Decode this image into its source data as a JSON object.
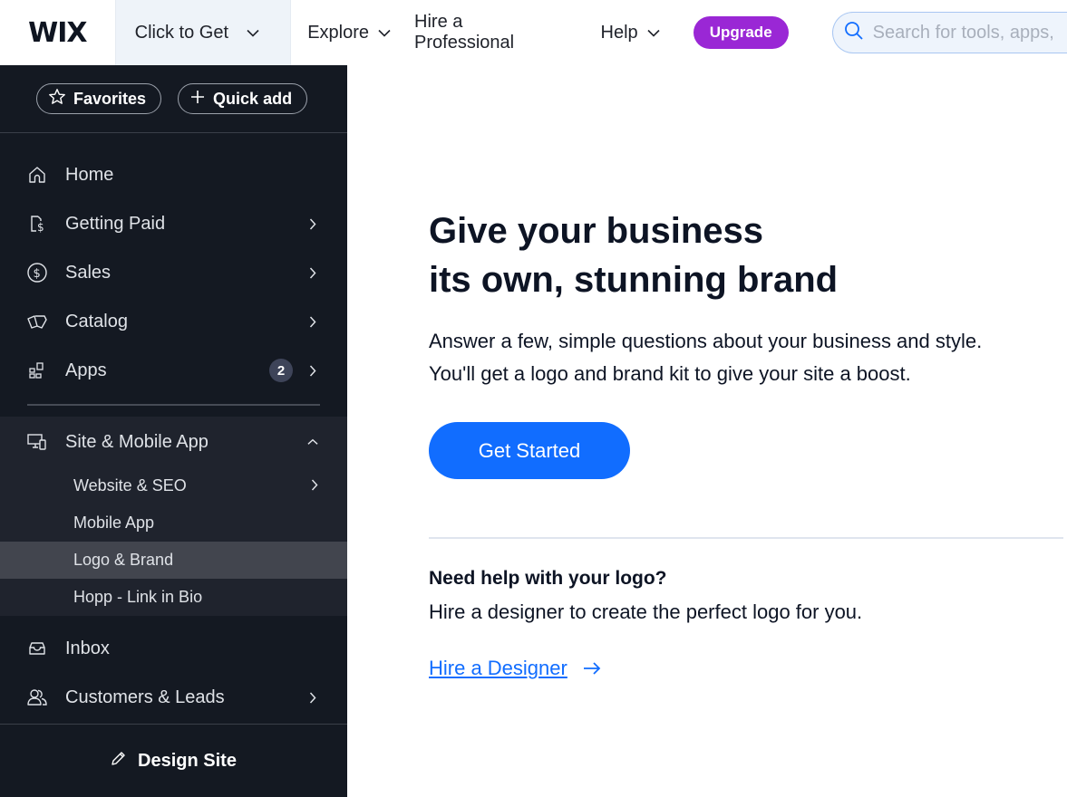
{
  "topbar": {
    "logo": "WIX",
    "site_switcher": "Click to Get",
    "nav": [
      {
        "label": "Explore",
        "has_dropdown": true
      },
      {
        "label": "Hire a Professional",
        "has_dropdown": false
      },
      {
        "label": "Help",
        "has_dropdown": true
      }
    ],
    "upgrade_label": "Upgrade",
    "search_placeholder": "Search for tools, apps, help & more..."
  },
  "sidebar": {
    "favorites_label": "Favorites",
    "quick_add_label": "Quick add",
    "items": [
      {
        "label": "Home",
        "icon": "home-icon"
      },
      {
        "label": "Getting Paid",
        "icon": "invoice-dollar-icon",
        "has_arrow": true
      },
      {
        "label": "Sales",
        "icon": "dollar-circle-icon",
        "has_arrow": true
      },
      {
        "label": "Catalog",
        "icon": "catalog-cards-icon",
        "has_arrow": true
      },
      {
        "label": "Apps",
        "icon": "apps-grid-icon",
        "badge": "2",
        "has_arrow": true
      }
    ],
    "group": {
      "label": "Site & Mobile App",
      "icon": "devices-icon",
      "expanded": true,
      "sub_items": [
        {
          "label": "Website & SEO",
          "has_arrow": true
        },
        {
          "label": "Mobile App"
        },
        {
          "label": "Logo & Brand",
          "active": true
        },
        {
          "label": "Hopp - Link in Bio"
        }
      ]
    },
    "bottom_items": [
      {
        "label": "Inbox",
        "icon": "inbox-icon"
      },
      {
        "label": "Customers & Leads",
        "icon": "people-icon",
        "has_arrow": true
      }
    ],
    "footer_label": "Design Site"
  },
  "main": {
    "headline_line1": "Give your business",
    "headline_line2": "its own, stunning brand",
    "subtext_line1": "Answer a few, simple questions about your business and style.",
    "subtext_line2": "You'll get a logo and brand kit to give your site a boost.",
    "cta_label": "Get Started",
    "help_title": "Need help with your logo?",
    "help_text": "Hire a designer to create the perfect logo for you.",
    "hire_link": "Hire a Designer"
  },
  "colors": {
    "accent": "#116dff",
    "upgrade": "#9a27d5",
    "sidebar_bg": "#141922",
    "sidebar_group_bg": "#1f232d",
    "sidebar_active_bg": "#42454e",
    "badge_bg": "#3e4459"
  }
}
